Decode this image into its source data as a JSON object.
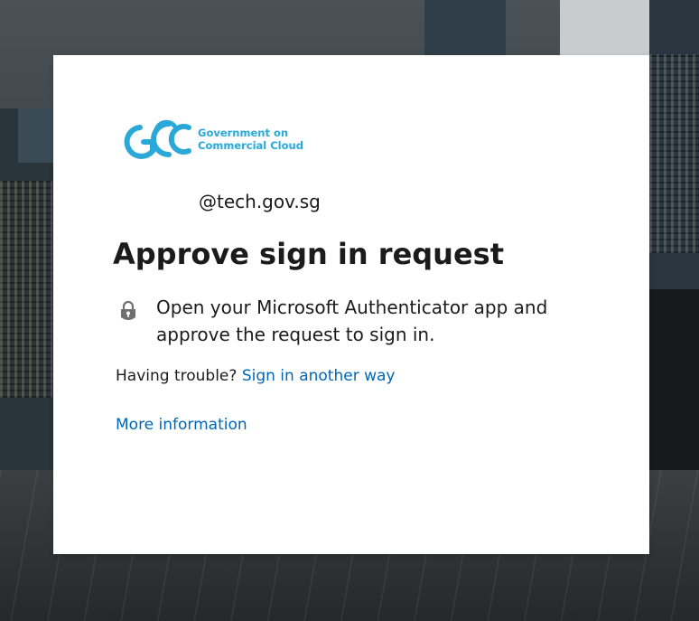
{
  "brand": {
    "logo_line1": "Government on",
    "logo_line2": "Commercial Cloud",
    "accent_color": "#2aa8d8"
  },
  "account": {
    "username": "@tech.gov.sg"
  },
  "heading": "Approve sign in request",
  "message": "Open your Microsoft Authenticator app and approve the request to sign in.",
  "message_icon": "lock-icon",
  "trouble": {
    "prefix": "Having trouble?",
    "link_label": "Sign in another way"
  },
  "more_info_label": "More information",
  "colors": {
    "link": "#0067b8",
    "text": "#1b1b1b",
    "card": "#ffffff"
  }
}
